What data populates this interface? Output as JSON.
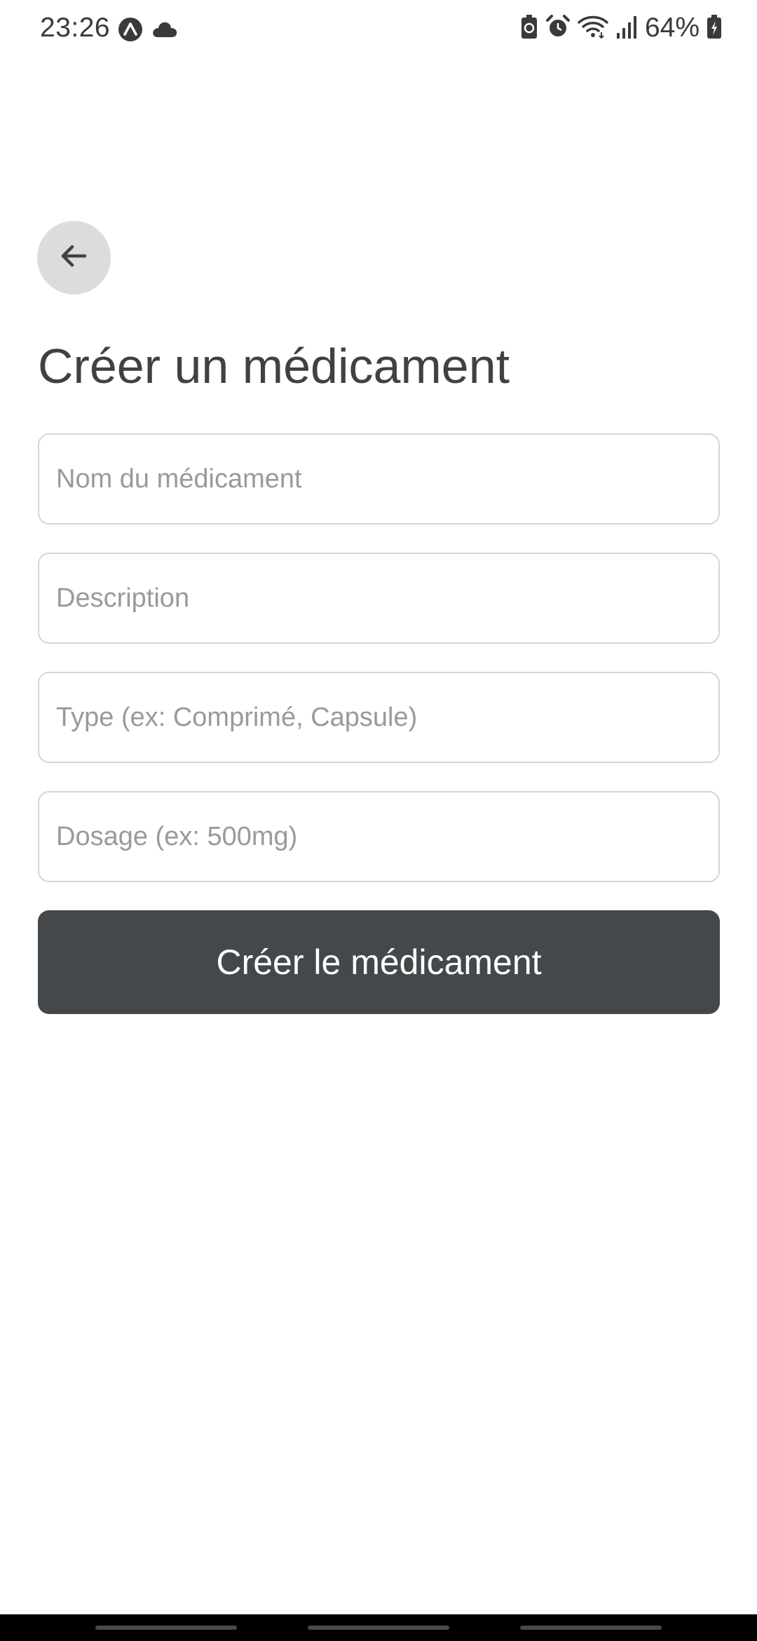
{
  "status_bar": {
    "time": "23:26",
    "battery_percent": "64%",
    "icons": [
      "expo-icon",
      "cloud-icon",
      "battery-saver-icon",
      "alarm-icon",
      "wifi-icon",
      "signal-icon",
      "battery-icon"
    ]
  },
  "header": {
    "back_icon": "arrow-left-icon",
    "title": "Créer un médicament"
  },
  "form": {
    "name_placeholder": "Nom du médicament",
    "description_placeholder": "Description",
    "type_placeholder": "Type (ex: Comprimé, Capsule)",
    "dosage_placeholder": "Dosage (ex: 500mg)",
    "submit_label": "Créer le médicament"
  },
  "colors": {
    "primary_button": "#45484b",
    "back_button_bg": "#dcdcdc",
    "field_border": "#d6d6d6",
    "placeholder": "#9a9a9a",
    "title": "#3f4244"
  }
}
